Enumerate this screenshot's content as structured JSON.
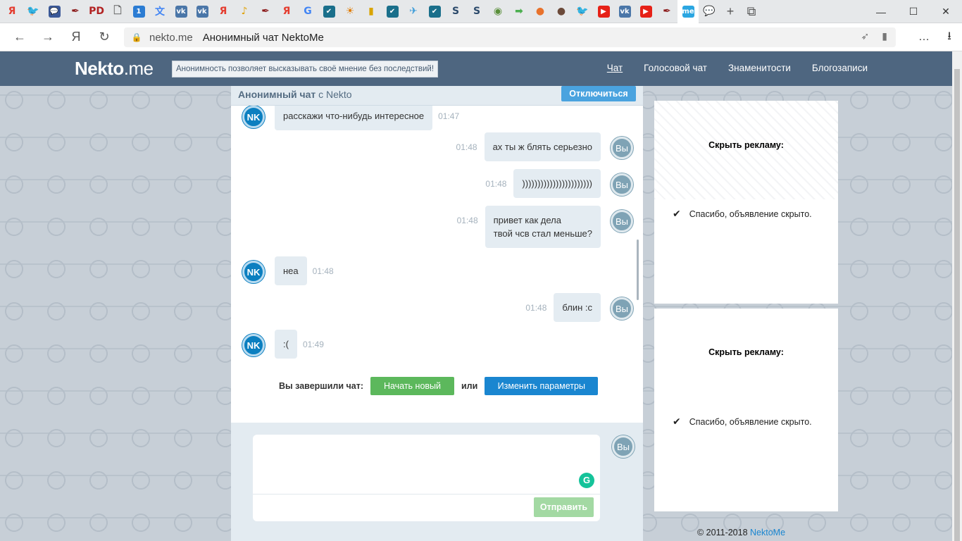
{
  "browser": {
    "tabs": [
      {
        "icon": "yandex-icon",
        "glyph": "Я",
        "color": "#e43d30",
        "text_color": "#e43d30",
        "bg": "transparent"
      },
      {
        "icon": "twitter-icon",
        "glyph": "🐦",
        "color": "#1da1f2",
        "bg": "transparent"
      },
      {
        "icon": "chat-icon",
        "glyph": "💬",
        "color": "#3b5998",
        "bg": "#3b5998"
      },
      {
        "icon": "quill-icon",
        "glyph": "✒",
        "color": "#8b1a1a",
        "bg": "transparent"
      },
      {
        "icon": "pd-icon",
        "glyph": "PD",
        "color": "#b22222",
        "bg": "transparent"
      },
      {
        "icon": "document-icon",
        "glyph": "🗋",
        "color": "#666",
        "bg": "transparent"
      },
      {
        "icon": "one-icon",
        "glyph": "1",
        "color": "#2b7cd3",
        "bg": "#2b7cd3"
      },
      {
        "icon": "translate-icon",
        "glyph": "文",
        "color": "#4285f4",
        "bg": "transparent"
      },
      {
        "icon": "vk-icon",
        "glyph": "vk",
        "color": "#4a76a8",
        "bg": "#4a76a8"
      },
      {
        "icon": "vk-icon",
        "glyph": "vk",
        "color": "#4a76a8",
        "bg": "#4a76a8"
      },
      {
        "icon": "yandex-icon",
        "glyph": "Я",
        "color": "#e43d30",
        "bg": "transparent"
      },
      {
        "icon": "tiktok-icon",
        "glyph": "♪",
        "color": "#e0a000",
        "bg": "transparent"
      },
      {
        "icon": "quill-icon",
        "glyph": "✒",
        "color": "#8b1a1a",
        "bg": "transparent"
      },
      {
        "icon": "yandex-icon",
        "glyph": "Я",
        "color": "#e43d30",
        "bg": "transparent"
      },
      {
        "icon": "google-icon",
        "glyph": "G",
        "color": "#4285f4",
        "bg": "transparent"
      },
      {
        "icon": "check-icon",
        "glyph": "✔",
        "color": "#1a7f6b",
        "bg": "#1a6f8b"
      },
      {
        "icon": "sunset-icon",
        "glyph": "☀",
        "color": "#e07b00",
        "bg": "transparent"
      },
      {
        "icon": "barchart-icon",
        "glyph": "▮",
        "color": "#d9a400",
        "bg": "transparent"
      },
      {
        "icon": "check-icon",
        "glyph": "✔",
        "color": "#1a7f6b",
        "bg": "#1a6f8b"
      },
      {
        "icon": "plane-icon",
        "glyph": "✈",
        "color": "#3a9bd9",
        "bg": "transparent"
      },
      {
        "icon": "check-icon",
        "glyph": "✔",
        "color": "#1a7f6b",
        "bg": "#1a6f8b"
      },
      {
        "icon": "s-icon",
        "glyph": "S",
        "color": "#2c4a6b",
        "bg": "transparent"
      },
      {
        "icon": "s-icon",
        "glyph": "S",
        "color": "#2c4a6b",
        "bg": "transparent"
      },
      {
        "icon": "earth-icon",
        "glyph": "◉",
        "color": "#5a8f3a",
        "bg": "transparent"
      },
      {
        "icon": "arrow-icon",
        "glyph": "➡",
        "color": "#4caf50",
        "bg": "transparent"
      },
      {
        "icon": "basketball-icon",
        "glyph": "●",
        "color": "#e8722c",
        "bg": "transparent"
      },
      {
        "icon": "avatar-icon",
        "glyph": "●",
        "color": "#6b4a3a",
        "bg": "transparent"
      },
      {
        "icon": "twitter-icon",
        "glyph": "🐦",
        "color": "#1da1f2",
        "bg": "transparent"
      },
      {
        "icon": "youtube-icon",
        "glyph": "▶",
        "color": "#e62117",
        "bg": "#e62117"
      },
      {
        "icon": "vk-icon",
        "glyph": "vk",
        "color": "#4a76a8",
        "bg": "#4a76a8"
      },
      {
        "icon": "youtube-icon",
        "glyph": "▶",
        "color": "#e62117",
        "bg": "#e62117"
      },
      {
        "icon": "quill-icon",
        "glyph": "✒",
        "color": "#8b1a1a",
        "bg": "transparent"
      },
      {
        "icon": "nekto-icon",
        "glyph": "me",
        "color": "#2ba6e1",
        "bg": "#2ba6e1",
        "active": true
      },
      {
        "icon": "speech-icon",
        "glyph": "💬",
        "color": "#e03a2e",
        "bg": "transparent"
      }
    ],
    "new_tab_glyph": "+",
    "restore_glyph": "⧉",
    "window_controls": {
      "minimize": "—",
      "maximize": "☐",
      "close": "✕"
    },
    "nav": {
      "back": "←",
      "forward": "→",
      "yandex": "Я",
      "refresh": "↻"
    },
    "url_domain": "nekto.me",
    "url_title": "Анонимный чат NektoMe",
    "url_icons": {
      "lock": "🔒",
      "pin": "➶",
      "bookmark": "▮"
    },
    "right_icons": {
      "more": "…",
      "download": "⭳"
    }
  },
  "site": {
    "logo_bold": "Nekto",
    "logo_rest": ".me",
    "slogan": "Анонимность позволяет высказывать своё мнение без последствий!",
    "nav": [
      {
        "label": "Чат",
        "active": true
      },
      {
        "label": "Голосовой чат",
        "active": false
      },
      {
        "label": "Знаменитости",
        "active": false
      },
      {
        "label": "Блогозаписи",
        "active": false
      }
    ]
  },
  "chat": {
    "title_bold": "Анонимный чат",
    "title_rest": " с Nekto",
    "disconnect_label": "Отключиться",
    "nk_avatar": "NK",
    "me_avatar": "Вы",
    "messages": [
      {
        "from": "nk",
        "lines": [
          "расскажи что-нибудь интересное"
        ],
        "time": "01:47"
      },
      {
        "from": "me",
        "lines": [
          "ах ты ж блять серьезно"
        ],
        "time": "01:48"
      },
      {
        "from": "me",
        "lines": [
          ")))))))))))))))))))))))"
        ],
        "time": "01:48"
      },
      {
        "from": "me",
        "lines": [
          "привет как дела",
          "твой чсв стал меньше?"
        ],
        "time": "01:48"
      },
      {
        "from": "nk",
        "lines": [
          "неа"
        ],
        "time": "01:48"
      },
      {
        "from": "me",
        "lines": [
          "блин :c"
        ],
        "time": "01:48"
      },
      {
        "from": "nk",
        "lines": [
          ":("
        ],
        "time": "01:49"
      }
    ],
    "ended_label": "Вы завершили чат:",
    "start_new_label": "Начать новый",
    "or_label": "или",
    "change_params_label": "Изменить параметры",
    "message_placeholder": "",
    "grammarly_glyph": "G",
    "send_label": "Отправить"
  },
  "ads": [
    {
      "hide_label": "Скрыть рекламу:",
      "thanks_label": "Спасибо, объявление скрыто."
    },
    {
      "hide_label": "Скрыть рекламу:",
      "thanks_label": "Спасибо, объявление скрыто."
    }
  ],
  "footer": {
    "copyright": "© 2011-2018 ",
    "link": "NektoMe"
  }
}
